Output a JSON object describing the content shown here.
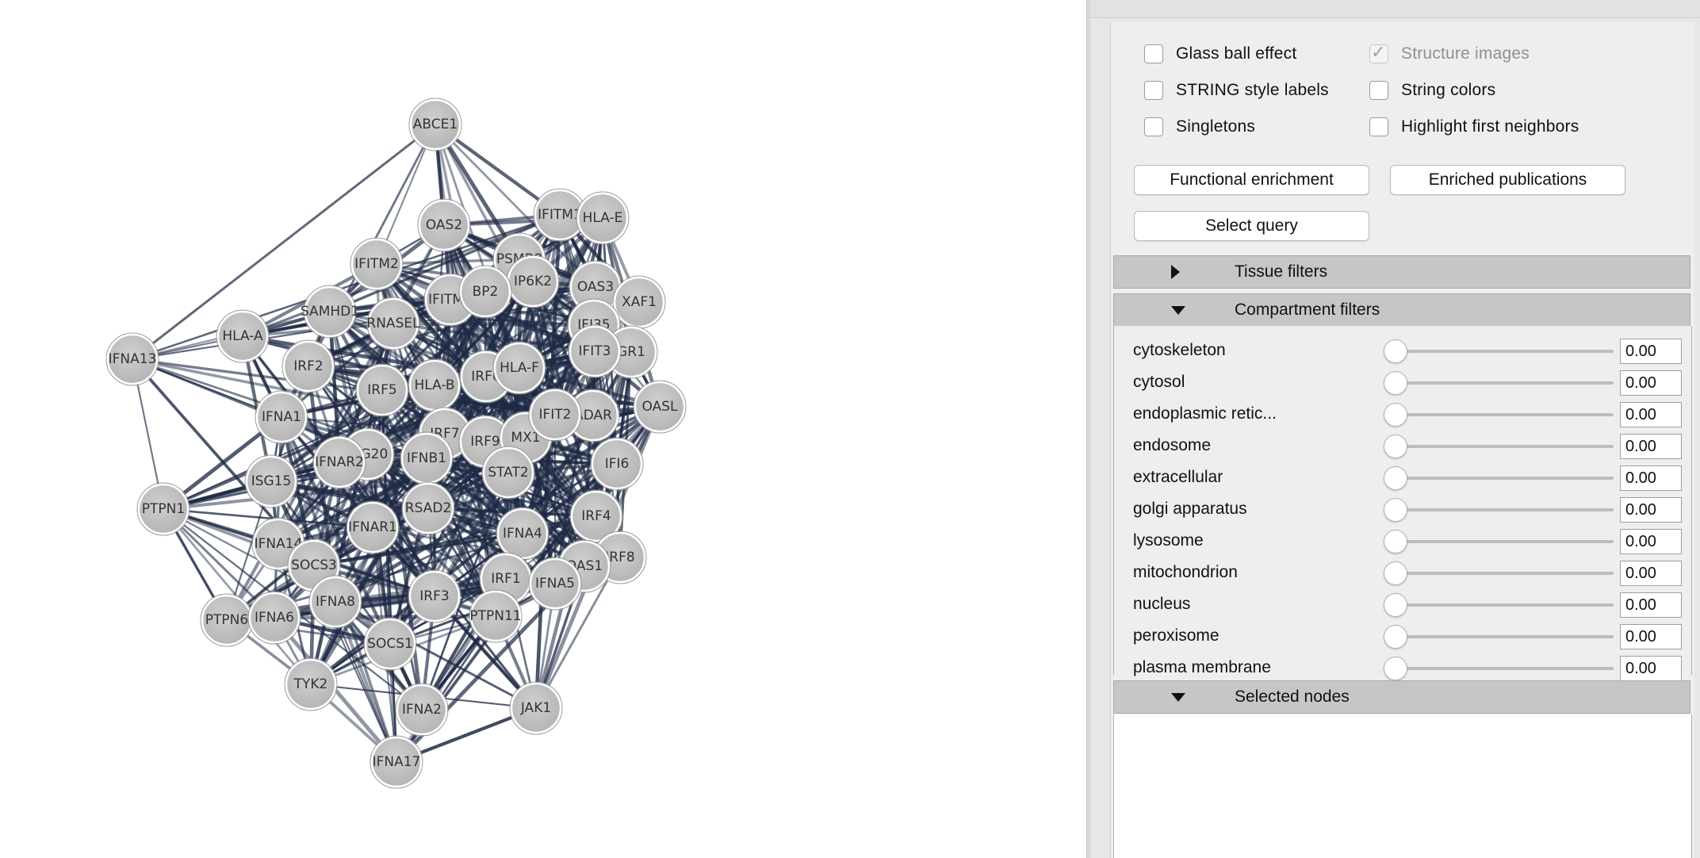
{
  "network": {
    "nodes": [
      "ABCE1",
      "OAS2",
      "IFITM1",
      "HLA-E",
      "IFITM2",
      "PSMB8",
      "IP6K2",
      "OAS3",
      "XAF1",
      "HLA-A",
      "SAMHD1",
      "RNASEL",
      "IFITM3",
      "BP2",
      "IFI35",
      "GR1",
      "IFNA13",
      "IRF2",
      "HLA-B",
      "IRF6",
      "HLA-F",
      "IRF5",
      "OASL",
      "IFNA1",
      "IFIT3",
      "ADAR",
      "IRF7",
      "IRF9",
      "MX1",
      "IFIT2",
      "ISG20",
      "IFNB1",
      "STAT2",
      "IFI6",
      "ISG15",
      "PTPN1",
      "IFNAR2",
      "IFNAR1",
      "RSAD2",
      "IRF4",
      "IFNA4",
      "IFNA14",
      "SOCS3",
      "IRF8",
      "OAS1",
      "IRF1",
      "IFNA5",
      "PTPN6",
      "IFNA6",
      "IFNA8",
      "IRF3",
      "PTPN11",
      "SOCS1",
      "TYK2",
      "IFNA2",
      "JAK1",
      "IFNA17"
    ]
  },
  "options": {
    "glass_ball": {
      "label": "Glass ball effect",
      "checked": false
    },
    "structure_images": {
      "label": "Structure images",
      "checked": true,
      "enabled": false
    },
    "string_labels": {
      "label": "STRING style labels",
      "checked": false
    },
    "string_colors": {
      "label": "String colors",
      "checked": false
    },
    "singletons": {
      "label": "Singletons",
      "checked": false
    },
    "highlight_neighbors": {
      "label": "Highlight first neighbors",
      "checked": false
    }
  },
  "buttons": {
    "functional_enrichment": "Functional enrichment",
    "enriched_publications": "Enriched publications",
    "select_query": "Select query"
  },
  "sections": {
    "tissue": {
      "label": "Tissue filters",
      "expanded": false
    },
    "compartment": {
      "label": "Compartment filters",
      "expanded": true
    },
    "selected": {
      "label": "Selected nodes",
      "expanded": true
    }
  },
  "compartments": [
    {
      "label": "cytoskeleton",
      "value": "0.00"
    },
    {
      "label": "cytosol",
      "value": "0.00"
    },
    {
      "label": "endoplasmic retic...",
      "value": "0.00"
    },
    {
      "label": "endosome",
      "value": "0.00"
    },
    {
      "label": "extracellular",
      "value": "0.00"
    },
    {
      "label": "golgi apparatus",
      "value": "0.00"
    },
    {
      "label": "lysosome",
      "value": "0.00"
    },
    {
      "label": "mitochondrion",
      "value": "0.00"
    },
    {
      "label": "nucleus",
      "value": "0.00"
    },
    {
      "label": "peroxisome",
      "value": "0.00"
    },
    {
      "label": "plasma membrane",
      "value": "0.00"
    }
  ],
  "colors": {
    "edge": "#1e2a45",
    "node_fill": "#c2c2c2",
    "node_stroke": "#ffffff",
    "section_header": "#c6c6c6"
  }
}
